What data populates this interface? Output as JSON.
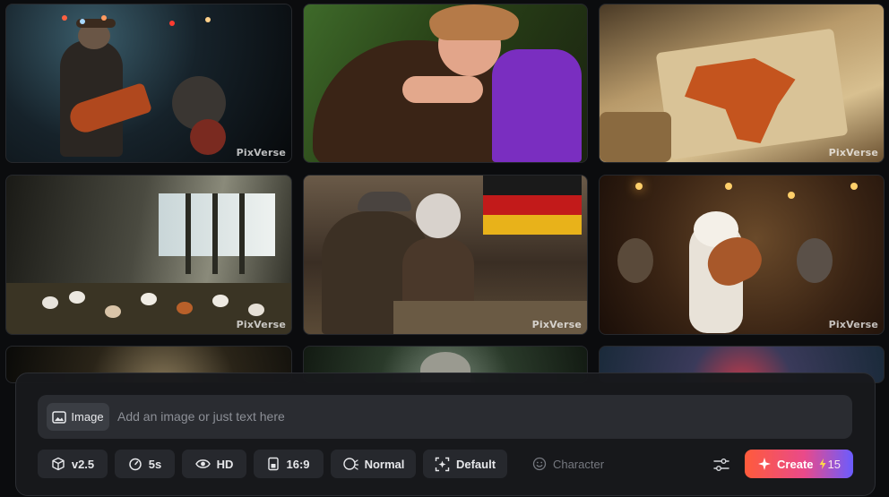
{
  "gallery": {
    "watermark": "PixVerse",
    "tiles": [
      {
        "name": "tile-rock-musician"
      },
      {
        "name": "tile-girl-hugging-beaver"
      },
      {
        "name": "tile-map-africa"
      },
      {
        "name": "tile-chickens-barn"
      },
      {
        "name": "tile-elderly-couple-coins"
      },
      {
        "name": "tile-bears-tavern"
      },
      {
        "name": "tile-partial-7"
      },
      {
        "name": "tile-partial-8"
      },
      {
        "name": "tile-partial-9"
      }
    ]
  },
  "composer": {
    "image_button_label": "Image",
    "prompt_placeholder": "Add an image or just text here",
    "chips": {
      "model": "v2.5",
      "duration": "5s",
      "quality": "HD",
      "ratio": "16:9",
      "motion": "Normal",
      "style": "Default",
      "character": "Character"
    },
    "create_label": "Create",
    "create_cost": "15"
  },
  "colors": {
    "background": "#0b0c0e",
    "panel": "#18191c",
    "chip": "#26282d",
    "create_gradient_start": "#ff5b3b",
    "create_gradient_end": "#6a5cff"
  },
  "icons": {
    "image_button": "image-icon",
    "model": "cube-icon",
    "duration": "timer-icon",
    "quality": "eye-icon",
    "ratio": "aspect-ratio-icon",
    "motion": "motion-icon",
    "style": "style-frame-icon",
    "character": "smiley-icon",
    "settings": "sliders-icon",
    "create": "sparkle-icon",
    "credit": "lightning-icon"
  }
}
